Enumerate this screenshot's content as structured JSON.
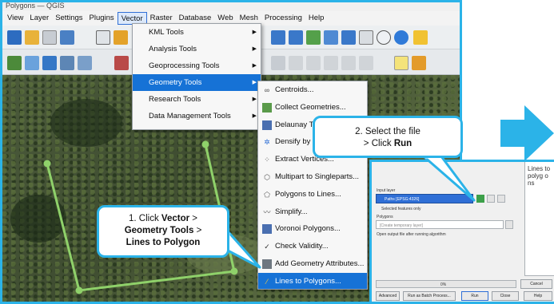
{
  "window": {
    "title": "Polygons — QGIS"
  },
  "menubar": {
    "items": [
      "View",
      "Layer",
      "Settings",
      "Plugins",
      "Vector",
      "Raster",
      "Database",
      "Web",
      "Mesh",
      "Processing",
      "Help"
    ],
    "open_item": "Vector"
  },
  "vector_menu": {
    "items": [
      "KML Tools",
      "Analysis Tools",
      "Geoprocessing Tools",
      "Geometry Tools",
      "Research Tools",
      "Data Management Tools"
    ],
    "highlighted": "Geometry Tools"
  },
  "geometry_menu": {
    "items": [
      {
        "label": "Centroids...",
        "icon": "centroids-icon"
      },
      {
        "label": "Collect Geometries...",
        "icon": "collect-icon"
      },
      {
        "label": "Delaunay Triangulation...",
        "icon": "delaunay-icon"
      },
      {
        "label": "Densify by Count...",
        "icon": "densify-icon"
      },
      {
        "label": "Extract Vertices...",
        "icon": "vertices-icon"
      },
      {
        "label": "Multipart to Singleparts...",
        "icon": "multipart-icon"
      },
      {
        "label": "Polygons to Lines...",
        "icon": "polygon-icon"
      },
      {
        "label": "Simplify...",
        "icon": "simplify-icon"
      },
      {
        "label": "Voronoi Polygons...",
        "icon": "voronoi-icon"
      },
      {
        "label": "Check Validity...",
        "icon": "check-icon"
      },
      {
        "label": "Add Geometry Attributes...",
        "icon": "attributes-icon"
      },
      {
        "label": "Lines to Polygons...",
        "icon": "lines-to-polygons-icon"
      }
    ],
    "highlighted": "Lines to Polygons..."
  },
  "callouts": {
    "step1": {
      "prefix": "1. Click ",
      "vector": "Vector",
      "sep1": " >",
      "geometry": "Geometry Tools",
      "sep2": " >",
      "lines": "Lines to Polygon"
    },
    "step2": {
      "line1": "2. Select the file",
      "prefix": "> Click ",
      "run": "Run"
    }
  },
  "dialog": {
    "input_layer_label": "Input layer",
    "input_layer_value": "Paths [EPSG:4326]",
    "selected_only": "Selected features only",
    "output_label": "Polygons",
    "output_placeholder": "[Create temporary layer]",
    "open_after": "Open output file after running algorithm",
    "progress": "0%",
    "side_title": "Lines to polyg ons",
    "buttons": {
      "advanced": "Advanced",
      "batch": "Run as Batch Process...",
      "run": "Run",
      "close": "Close",
      "help": "Help",
      "cancel": "Cancel"
    }
  },
  "colors": {
    "accent": "#2bb3e8",
    "highlight": "#1672d6",
    "polygon_line": "#8fd16a"
  }
}
